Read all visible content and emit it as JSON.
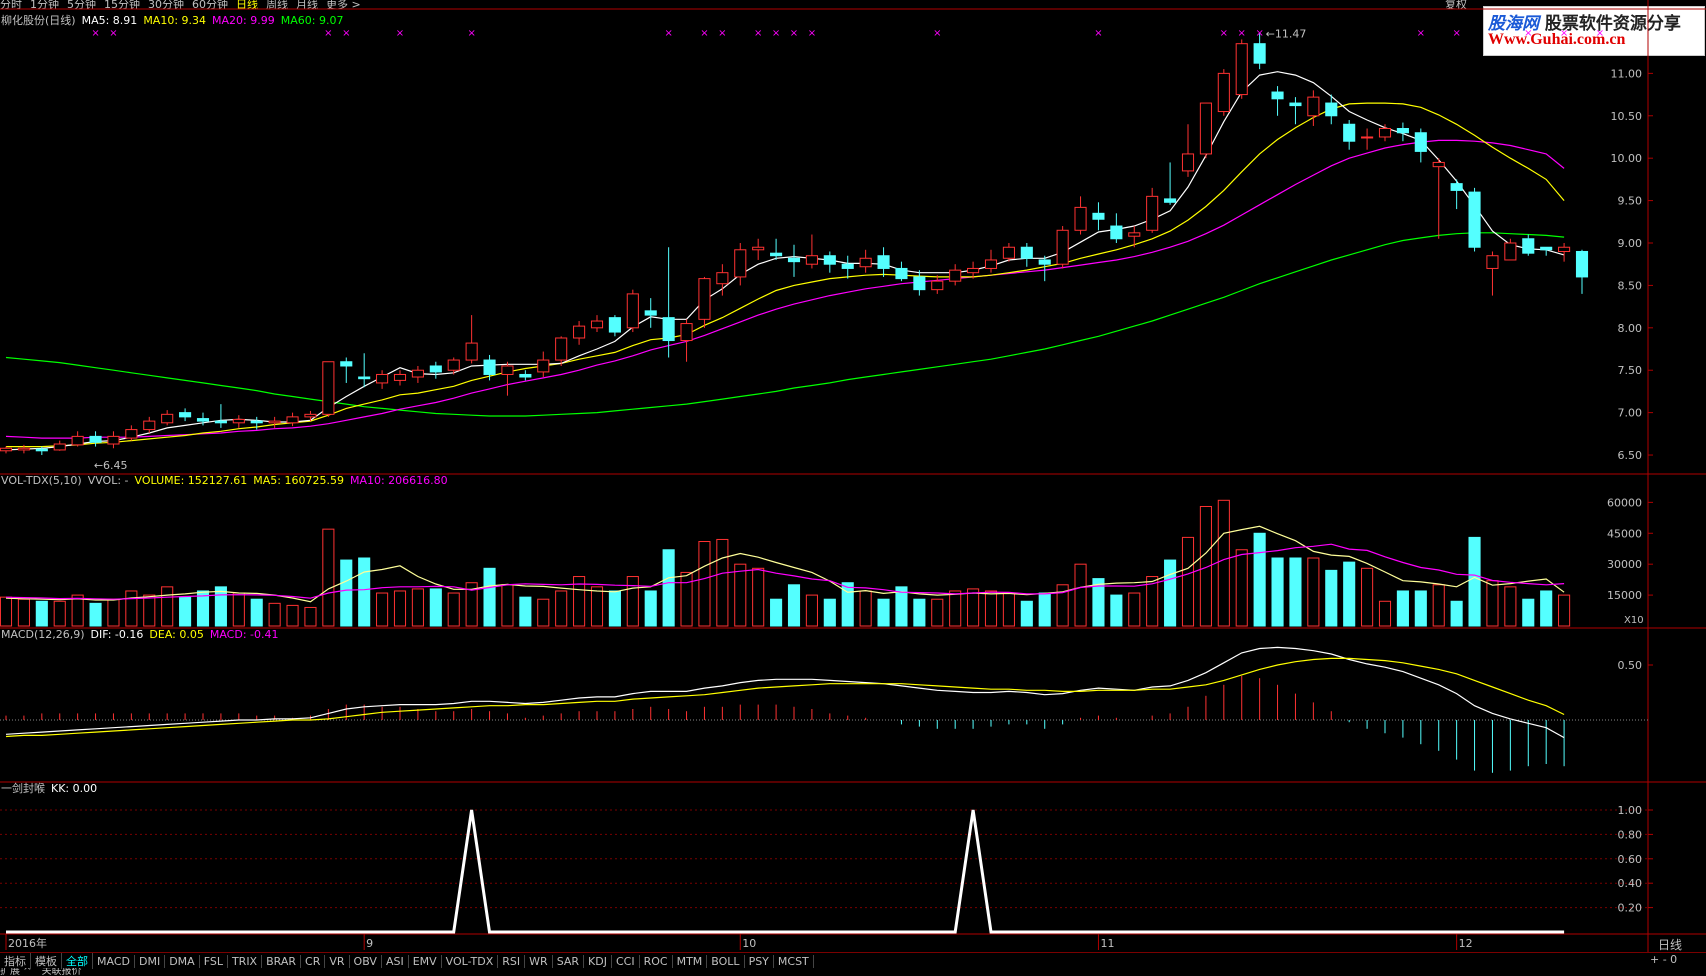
{
  "top_tabs": [
    "分时",
    "1分钟",
    "5分钟",
    "15分钟",
    "30分钟",
    "60分钟",
    "日线",
    "周线",
    "月线",
    "更多 >"
  ],
  "top_right_label": "复权",
  "watermark": {
    "site_cn": "股海网",
    "slogan": "股票软件资源分享",
    "url": "Www.Guhai.com.cn"
  },
  "panels": {
    "price": {
      "stock": "柳化股份(日线)",
      "ma5": "MA5: 8.91",
      "ma10": "MA10: 9.34",
      "ma20": "MA20: 9.99",
      "ma60": "MA60: 9.07",
      "high_label": "11.47",
      "low_label": "6.45",
      "yticks": [
        "11.00",
        "10.50",
        "10.00",
        "9.50",
        "9.00",
        "8.50",
        "8.00",
        "7.50",
        "7.00",
        "6.50"
      ]
    },
    "volume": {
      "name": "VOL-TDX(5,10)",
      "vvol": "VVOL: -",
      "volume": "VOLUME: 152127.61",
      "ma5": "MA5: 160725.59",
      "ma10": "MA10: 206616.80",
      "yticks": [
        "60000",
        "45000",
        "30000",
        "15000"
      ],
      "unit": "X10"
    },
    "macd": {
      "name": "MACD(12,26,9)",
      "dif": "DIF: -0.16",
      "dea": "DEA: 0.05",
      "macd": "MACD: -0.41",
      "ytick": "0.50"
    },
    "kk": {
      "name": "一剑封喉",
      "kk": "KK: 0.00",
      "yticks": [
        "1.00",
        "0.80",
        "0.60",
        "0.40",
        "0.20"
      ]
    }
  },
  "x_axis": {
    "labels": [
      "2016年",
      "9",
      "10",
      "11",
      "12"
    ]
  },
  "period_label": "日线",
  "zoom_label": "+  -  0",
  "bottom_tabs": [
    "指标",
    "模板",
    "全部",
    "MACD",
    "DMI",
    "DMA",
    "FSL",
    "TRIX",
    "BRAR",
    "CR",
    "VR",
    "OBV",
    "ASI",
    "EMV",
    "VOL-TDX",
    "RSI",
    "WR",
    "SAR",
    "KDJ",
    "CCI",
    "ROC",
    "MTM",
    "BOLL",
    "PSY",
    "MCST"
  ],
  "status_tabs": [
    "扩展 ^",
    "关联报价"
  ],
  "colors": {
    "up": "#ff3232",
    "down": "#54ffff",
    "ma5": "#ffffff",
    "ma10": "#ffff00",
    "ma20": "#ff00ff",
    "ma60": "#00ff00",
    "grid": "#7a0000",
    "frame": "#b00000"
  },
  "chart_data": {
    "type": "candlestick",
    "ylim": [
      6.3,
      11.7
    ],
    "candles": [
      [
        6.55,
        6.58,
        6.52,
        6.6
      ],
      [
        6.56,
        6.58,
        6.52,
        6.62
      ],
      [
        6.57,
        6.55,
        6.5,
        6.6
      ],
      [
        6.56,
        6.63,
        6.55,
        6.67
      ],
      [
        6.62,
        6.72,
        6.6,
        6.78
      ],
      [
        6.72,
        6.65,
        6.6,
        6.78
      ],
      [
        6.63,
        6.72,
        6.58,
        6.78
      ],
      [
        6.7,
        6.8,
        6.67,
        6.85
      ],
      [
        6.8,
        6.9,
        6.76,
        6.95
      ],
      [
        6.88,
        6.98,
        6.85,
        7.03
      ],
      [
        7.0,
        6.95,
        6.9,
        7.05
      ],
      [
        6.93,
        6.9,
        6.85,
        7.0
      ],
      [
        6.9,
        6.88,
        6.82,
        7.1
      ],
      [
        6.88,
        6.92,
        6.82,
        6.97
      ],
      [
        6.9,
        6.88,
        6.8,
        6.95
      ],
      [
        6.88,
        6.9,
        6.82,
        6.95
      ],
      [
        6.88,
        6.95,
        6.84,
        7.0
      ],
      [
        6.95,
        6.98,
        6.9,
        7.02
      ],
      [
        6.98,
        7.6,
        6.95,
        7.6
      ],
      [
        7.6,
        7.55,
        7.35,
        7.65
      ],
      [
        7.42,
        7.4,
        7.3,
        7.7
      ],
      [
        7.35,
        7.45,
        7.28,
        7.5
      ],
      [
        7.38,
        7.45,
        7.32,
        7.5
      ],
      [
        7.42,
        7.5,
        7.35,
        7.55
      ],
      [
        7.55,
        7.48,
        7.4,
        7.6
      ],
      [
        7.5,
        7.62,
        7.45,
        7.65
      ],
      [
        7.62,
        7.82,
        7.58,
        8.15
      ],
      [
        7.62,
        7.45,
        7.38,
        7.68
      ],
      [
        7.45,
        7.55,
        7.2,
        7.6
      ],
      [
        7.45,
        7.42,
        7.38,
        7.5
      ],
      [
        7.48,
        7.62,
        7.42,
        7.72
      ],
      [
        7.62,
        7.88,
        7.55,
        7.9
      ],
      [
        7.88,
        8.02,
        7.8,
        8.08
      ],
      [
        8.0,
        8.08,
        7.95,
        8.15
      ],
      [
        8.12,
        7.95,
        7.9,
        8.15
      ],
      [
        8.0,
        8.4,
        7.95,
        8.45
      ],
      [
        8.2,
        8.15,
        8.0,
        8.35
      ],
      [
        8.12,
        7.85,
        7.65,
        8.95
      ],
      [
        7.85,
        8.05,
        7.6,
        8.1
      ],
      [
        8.1,
        8.58,
        8.0,
        8.6
      ],
      [
        8.52,
        8.65,
        8.38,
        8.75
      ],
      [
        8.6,
        8.92,
        8.5,
        9.0
      ],
      [
        8.92,
        8.95,
        8.8,
        9.05
      ],
      [
        8.88,
        8.85,
        8.8,
        9.05
      ],
      [
        8.82,
        8.78,
        8.6,
        8.98
      ],
      [
        8.75,
        8.85,
        8.7,
        9.1
      ],
      [
        8.85,
        8.75,
        8.65,
        8.9
      ],
      [
        8.75,
        8.7,
        8.58,
        8.85
      ],
      [
        8.72,
        8.82,
        8.65,
        8.92
      ],
      [
        8.85,
        8.7,
        8.6,
        8.95
      ],
      [
        8.7,
        8.58,
        8.55,
        8.78
      ],
      [
        8.6,
        8.45,
        8.38,
        8.68
      ],
      [
        8.45,
        8.55,
        8.4,
        8.62
      ],
      [
        8.55,
        8.68,
        8.5,
        8.75
      ],
      [
        8.65,
        8.7,
        8.58,
        8.78
      ],
      [
        8.7,
        8.8,
        8.65,
        8.92
      ],
      [
        8.82,
        8.95,
        8.78,
        9.0
      ],
      [
        8.95,
        8.82,
        8.72,
        9.0
      ],
      [
        8.8,
        8.75,
        8.55,
        8.85
      ],
      [
        8.75,
        9.15,
        8.7,
        9.2
      ],
      [
        9.15,
        9.42,
        9.1,
        9.55
      ],
      [
        9.35,
        9.28,
        9.15,
        9.48
      ],
      [
        9.2,
        9.05,
        9.0,
        9.35
      ],
      [
        9.08,
        9.12,
        8.95,
        9.2
      ],
      [
        9.15,
        9.55,
        9.12,
        9.65
      ],
      [
        9.52,
        9.48,
        9.45,
        9.95
      ],
      [
        9.85,
        10.05,
        9.78,
        10.4
      ],
      [
        10.05,
        10.65,
        10.0,
        10.6
      ],
      [
        10.55,
        11.0,
        10.5,
        11.05
      ],
      [
        10.75,
        11.35,
        10.7,
        11.4
      ],
      [
        11.35,
        11.12,
        11.05,
        11.47
      ],
      [
        10.78,
        10.7,
        10.5,
        10.85
      ],
      [
        10.65,
        10.62,
        10.4,
        10.72
      ],
      [
        10.5,
        10.72,
        10.38,
        10.8
      ],
      [
        10.65,
        10.5,
        10.4,
        10.75
      ],
      [
        10.4,
        10.2,
        10.1,
        10.45
      ],
      [
        10.25,
        10.25,
        10.1,
        10.35
      ],
      [
        10.25,
        10.35,
        10.2,
        10.4
      ],
      [
        10.35,
        10.3,
        10.2,
        10.42
      ],
      [
        10.3,
        10.08,
        9.95,
        10.35
      ],
      [
        9.9,
        9.95,
        9.05,
        10.0
      ],
      [
        9.7,
        9.62,
        9.4,
        9.75
      ],
      [
        9.6,
        8.95,
        8.9,
        9.65
      ],
      [
        8.7,
        8.85,
        8.38,
        8.9
      ],
      [
        8.8,
        9.0,
        8.8,
        9.05
      ],
      [
        9.05,
        8.88,
        8.85,
        9.1
      ],
      [
        8.95,
        8.92,
        8.85,
        8.95
      ],
      [
        8.9,
        8.95,
        8.78,
        9.0
      ],
      [
        8.9,
        8.6,
        8.4,
        8.92
      ]
    ],
    "ma5": [
      6.56,
      6.57,
      6.58,
      6.6,
      6.63,
      6.66,
      6.67,
      6.71,
      6.76,
      6.82,
      6.85,
      6.88,
      6.91,
      6.92,
      6.91,
      6.89,
      6.89,
      6.91,
      7.06,
      7.19,
      7.31,
      7.42,
      7.53,
      7.46,
      7.45,
      7.47,
      7.55,
      7.56,
      7.57,
      7.57,
      7.57,
      7.58,
      7.67,
      7.75,
      7.84,
      8.01,
      8.13,
      8.1,
      8.1,
      8.33,
      8.46,
      8.63,
      8.75,
      8.82,
      8.84,
      8.82,
      8.8,
      8.76,
      8.76,
      8.75,
      8.68,
      8.65,
      8.65,
      8.65,
      8.68,
      8.73,
      8.8,
      8.82,
      8.82,
      8.89,
      9.01,
      9.13,
      9.16,
      9.2,
      9.28,
      9.38,
      9.66,
      10.03,
      10.43,
      10.78,
      10.98,
      11.02,
      10.98,
      10.89,
      10.73,
      10.55,
      10.45,
      10.36,
      10.29,
      10.21,
      9.98,
      9.73,
      9.44,
      9.14,
      8.98,
      8.93,
      8.92,
      8.86
    ],
    "ma10": [
      6.6,
      6.6,
      6.6,
      6.61,
      6.62,
      6.64,
      6.65,
      6.67,
      6.69,
      6.71,
      6.73,
      6.76,
      6.78,
      6.81,
      6.83,
      6.86,
      6.88,
      6.9,
      6.97,
      7.05,
      7.1,
      7.15,
      7.21,
      7.23,
      7.27,
      7.31,
      7.38,
      7.43,
      7.48,
      7.52,
      7.55,
      7.58,
      7.63,
      7.67,
      7.71,
      7.79,
      7.86,
      7.88,
      7.92,
      8.03,
      8.12,
      8.23,
      8.34,
      8.44,
      8.5,
      8.54,
      8.58,
      8.6,
      8.62,
      8.63,
      8.62,
      8.61,
      8.6,
      8.6,
      8.6,
      8.62,
      8.65,
      8.68,
      8.72,
      8.76,
      8.82,
      8.87,
      8.92,
      8.98,
      9.05,
      9.14,
      9.27,
      9.43,
      9.62,
      9.84,
      10.05,
      10.22,
      10.36,
      10.48,
      10.58,
      10.64,
      10.65,
      10.65,
      10.64,
      10.6,
      10.51,
      10.4,
      10.27,
      10.13,
      10.0,
      9.88,
      9.75,
      9.5
    ],
    "ma20": [
      6.72,
      6.71,
      6.7,
      6.7,
      6.7,
      6.71,
      6.71,
      6.71,
      6.72,
      6.73,
      6.74,
      6.75,
      6.76,
      6.78,
      6.79,
      6.81,
      6.82,
      6.84,
      6.87,
      6.91,
      6.95,
      6.99,
      7.04,
      7.08,
      7.12,
      7.17,
      7.23,
      7.28,
      7.33,
      7.37,
      7.41,
      7.45,
      7.5,
      7.56,
      7.61,
      7.67,
      7.74,
      7.79,
      7.84,
      7.91,
      7.99,
      8.07,
      8.15,
      8.22,
      8.28,
      8.33,
      8.38,
      8.42,
      8.46,
      8.49,
      8.52,
      8.54,
      8.56,
      8.58,
      8.6,
      8.62,
      8.64,
      8.66,
      8.68,
      8.71,
      8.74,
      8.77,
      8.8,
      8.84,
      8.89,
      8.95,
      9.02,
      9.11,
      9.21,
      9.33,
      9.45,
      9.57,
      9.69,
      9.8,
      9.91,
      10.0,
      10.06,
      10.12,
      10.16,
      10.19,
      10.21,
      10.21,
      10.2,
      10.18,
      10.15,
      10.1,
      10.05,
      9.88
    ],
    "ma60": [
      7.65,
      7.63,
      7.61,
      7.59,
      7.56,
      7.53,
      7.5,
      7.47,
      7.44,
      7.41,
      7.38,
      7.35,
      7.32,
      7.29,
      7.26,
      7.22,
      7.19,
      7.16,
      7.13,
      7.1,
      7.07,
      7.05,
      7.03,
      7.01,
      6.99,
      6.98,
      6.97,
      6.96,
      6.96,
      6.96,
      6.97,
      6.98,
      6.99,
      7.0,
      7.02,
      7.04,
      7.06,
      7.08,
      7.1,
      7.13,
      7.16,
      7.19,
      7.22,
      7.25,
      7.29,
      7.32,
      7.35,
      7.39,
      7.42,
      7.45,
      7.48,
      7.51,
      7.54,
      7.57,
      7.6,
      7.63,
      7.67,
      7.71,
      7.75,
      7.8,
      7.85,
      7.9,
      7.96,
      8.02,
      8.08,
      8.15,
      8.22,
      8.29,
      8.36,
      8.44,
      8.52,
      8.59,
      8.66,
      8.73,
      8.8,
      8.86,
      8.92,
      8.98,
      9.03,
      9.06,
      9.09,
      9.11,
      9.12,
      9.12,
      9.11,
      9.1,
      9.09,
      9.07
    ],
    "volume": [
      14000,
      13000,
      12000,
      12000,
      15000,
      11000,
      13000,
      17000,
      15000,
      19000,
      14000,
      17000,
      19000,
      16000,
      13000,
      11000,
      10000,
      9000,
      47000,
      32000,
      33000,
      16000,
      17000,
      18000,
      18000,
      16000,
      21000,
      28000,
      20000,
      14000,
      13000,
      17000,
      24000,
      19000,
      17000,
      24000,
      17000,
      37000,
      26000,
      41000,
      42000,
      30000,
      28000,
      13000,
      20000,
      15000,
      13000,
      21000,
      17000,
      13000,
      19000,
      13000,
      13000,
      17000,
      18000,
      17000,
      16000,
      12000,
      16000,
      20000,
      30000,
      23000,
      15000,
      16000,
      24000,
      32000,
      43000,
      58000,
      61000,
      37000,
      45000,
      33000,
      33000,
      33000,
      27000,
      31000,
      28000,
      12000,
      17000,
      17000,
      20000,
      12000,
      43000,
      22000,
      19000,
      13000,
      17000,
      15000
    ],
    "vol_ma5": [
      13500,
      13200,
      13000,
      12800,
      13200,
      12600,
      12600,
      13600,
      14200,
      15000,
      15600,
      16400,
      16800,
      16000,
      15800,
      15000,
      13600,
      11800,
      18000,
      21800,
      26200,
      27400,
      29200,
      24000,
      20400,
      17800,
      17800,
      19400,
      20200,
      19400,
      19200,
      18400,
      17600,
      17000,
      16600,
      18400,
      19000,
      23400,
      24400,
      29000,
      33000,
      35200,
      33400,
      30800,
      28400,
      26000,
      21800,
      16400,
      17200,
      15800,
      16600,
      15600,
      15000,
      15400,
      16000,
      15600,
      15800,
      15200,
      15800,
      16600,
      18800,
      20200,
      20800,
      21000,
      21600,
      25000,
      28000,
      35400,
      45000,
      46800,
      48400,
      44800,
      41400,
      36200,
      34400,
      33800,
      30400,
      26200,
      22000,
      21400,
      20400,
      19000,
      23600,
      19800,
      20600,
      21800,
      22800,
      16400
    ],
    "vol_ma10": [
      14000,
      13800,
      13600,
      13300,
      13400,
      13200,
      13000,
      13300,
      13600,
      14000,
      14300,
      14600,
      15100,
      15200,
      15100,
      14900,
      14300,
      13500,
      16000,
      17400,
      17600,
      18600,
      19000,
      19000,
      19200,
      19000,
      17400,
      18700,
      20000,
      20500,
      20200,
      20000,
      20400,
      20200,
      19800,
      19600,
      19200,
      21000,
      21000,
      23000,
      25600,
      26600,
      27400,
      25600,
      24300,
      22800,
      22000,
      18800,
      18500,
      17600,
      16400,
      16200,
      16000,
      15600,
      16000,
      16400,
      16300,
      15600,
      15600,
      16200,
      18700,
      19400,
      19400,
      19300,
      20500,
      22700,
      25300,
      28400,
      32200,
      34700,
      35600,
      36600,
      38000,
      38700,
      39700,
      37300,
      36700,
      33600,
      30800,
      28400,
      27200,
      25100,
      24700,
      22100,
      21200,
      20600,
      20000,
      20600
    ],
    "dif": [
      -0.13,
      -0.12,
      -0.11,
      -0.1,
      -0.09,
      -0.08,
      -0.07,
      -0.06,
      -0.05,
      -0.04,
      -0.03,
      -0.02,
      -0.01,
      0.0,
      0.0,
      0.01,
      0.01,
      0.02,
      0.06,
      0.1,
      0.12,
      0.13,
      0.14,
      0.14,
      0.14,
      0.15,
      0.17,
      0.17,
      0.16,
      0.15,
      0.16,
      0.18,
      0.2,
      0.21,
      0.21,
      0.24,
      0.26,
      0.26,
      0.26,
      0.29,
      0.31,
      0.34,
      0.36,
      0.37,
      0.37,
      0.37,
      0.36,
      0.35,
      0.34,
      0.33,
      0.31,
      0.29,
      0.27,
      0.26,
      0.25,
      0.25,
      0.26,
      0.25,
      0.23,
      0.24,
      0.27,
      0.29,
      0.28,
      0.27,
      0.3,
      0.31,
      0.36,
      0.43,
      0.52,
      0.61,
      0.65,
      0.66,
      0.65,
      0.63,
      0.6,
      0.55,
      0.51,
      0.48,
      0.44,
      0.38,
      0.32,
      0.24,
      0.13,
      0.06,
      0.01,
      -0.03,
      -0.07,
      -0.16
    ],
    "dea": [
      -0.15,
      -0.14,
      -0.14,
      -0.13,
      -0.12,
      -0.11,
      -0.1,
      -0.09,
      -0.08,
      -0.07,
      -0.06,
      -0.05,
      -0.04,
      -0.03,
      -0.02,
      -0.01,
      0.0,
      0.0,
      0.01,
      0.03,
      0.05,
      0.07,
      0.08,
      0.09,
      0.1,
      0.11,
      0.12,
      0.13,
      0.13,
      0.14,
      0.14,
      0.15,
      0.16,
      0.17,
      0.17,
      0.19,
      0.2,
      0.21,
      0.22,
      0.23,
      0.25,
      0.27,
      0.29,
      0.3,
      0.31,
      0.32,
      0.33,
      0.33,
      0.33,
      0.33,
      0.33,
      0.32,
      0.31,
      0.3,
      0.29,
      0.28,
      0.28,
      0.27,
      0.27,
      0.26,
      0.26,
      0.27,
      0.27,
      0.27,
      0.28,
      0.28,
      0.3,
      0.32,
      0.36,
      0.41,
      0.46,
      0.5,
      0.53,
      0.55,
      0.56,
      0.56,
      0.55,
      0.54,
      0.52,
      0.49,
      0.46,
      0.42,
      0.36,
      0.3,
      0.24,
      0.18,
      0.13,
      0.05
    ],
    "kk": [
      0,
      0,
      0,
      0,
      0,
      0,
      0,
      0,
      0,
      0,
      0,
      0,
      0,
      0,
      0,
      0,
      0,
      0,
      0,
      0,
      0,
      0,
      0,
      0,
      0,
      0,
      1,
      0,
      0,
      0,
      0,
      0,
      0,
      0,
      0,
      0,
      0,
      0,
      0,
      0,
      0,
      0,
      0,
      0,
      0,
      0,
      0,
      0,
      0,
      0,
      0,
      0,
      0,
      0,
      1,
      0,
      0,
      0,
      0,
      0,
      0,
      0,
      0,
      0,
      0,
      0,
      0,
      0,
      0,
      0,
      0,
      0,
      0,
      0,
      0,
      0,
      0,
      0,
      0,
      0,
      0,
      0,
      0,
      0,
      0,
      0,
      0,
      0
    ],
    "markers": [
      5,
      6,
      18,
      19,
      22,
      26,
      37,
      39,
      40,
      42,
      43,
      44,
      45,
      52,
      61,
      68,
      69,
      70,
      79,
      81,
      85,
      87,
      89
    ]
  }
}
